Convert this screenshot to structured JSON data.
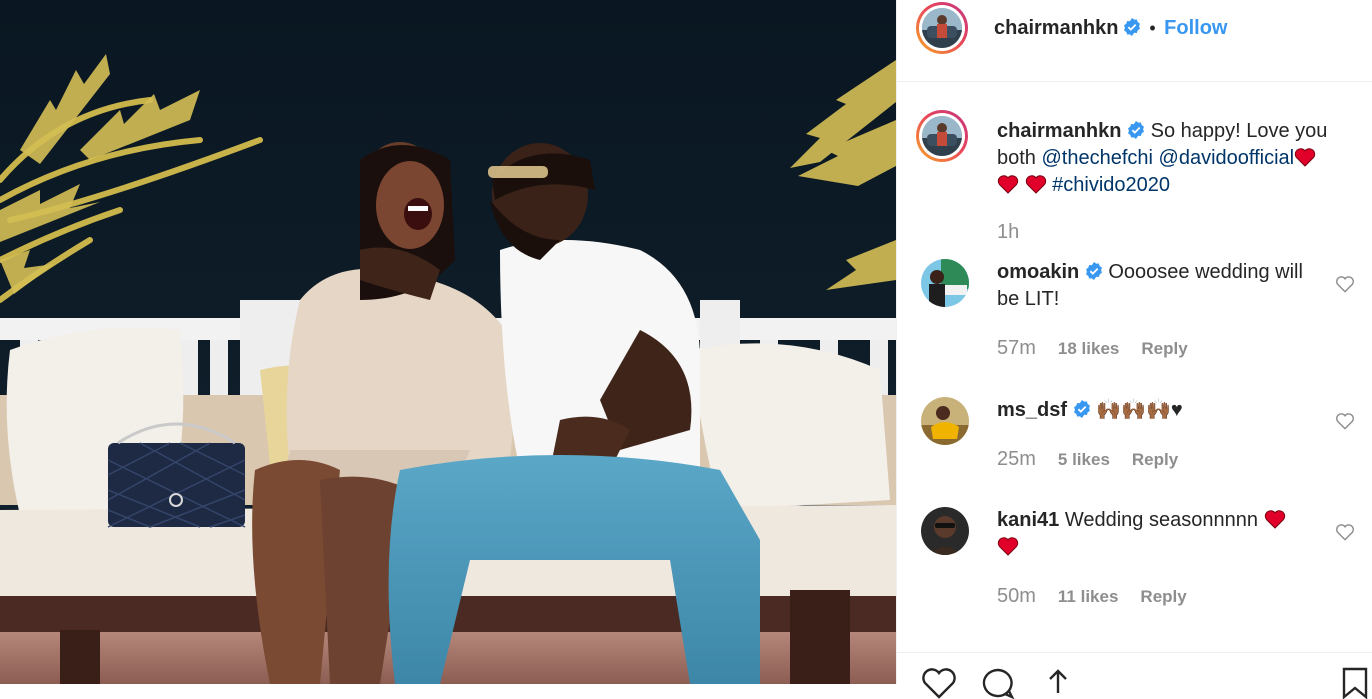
{
  "post": {
    "author": "chairmanhkn",
    "follow_label": "Follow",
    "separator": "•",
    "caption": {
      "author": "chairmanhkn",
      "text_1": "So happy! Love you both ",
      "mention_1": "@thechefchi",
      "mention_2": "@davidoofficial",
      "hashtag": "#chivido2020",
      "time": "1h"
    }
  },
  "comments": [
    {
      "user": "omoakin",
      "verified": true,
      "text": "Oooosee wedding will be LIT!",
      "time": "57m",
      "likes": "18 likes",
      "reply": "Reply"
    },
    {
      "user": "ms_dsf",
      "verified": true,
      "text": "🙌🏾🙌🏾🙌🏾♥",
      "time": "25m",
      "likes": "5 likes",
      "reply": "Reply"
    },
    {
      "user": "kani41",
      "verified": false,
      "text": "Wedding seasonnnnn",
      "time": "50m",
      "likes": "11 likes",
      "reply": "Reply"
    }
  ],
  "icons": [
    "verified-badge-icon",
    "heart-emoji-icon",
    "like-heart-icon",
    "comment-icon",
    "share-icon",
    "save-icon"
  ],
  "colors": {
    "link": "#3897f0",
    "mention": "#003569",
    "muted": "#8e8e8e",
    "heart": "#e0002a"
  }
}
